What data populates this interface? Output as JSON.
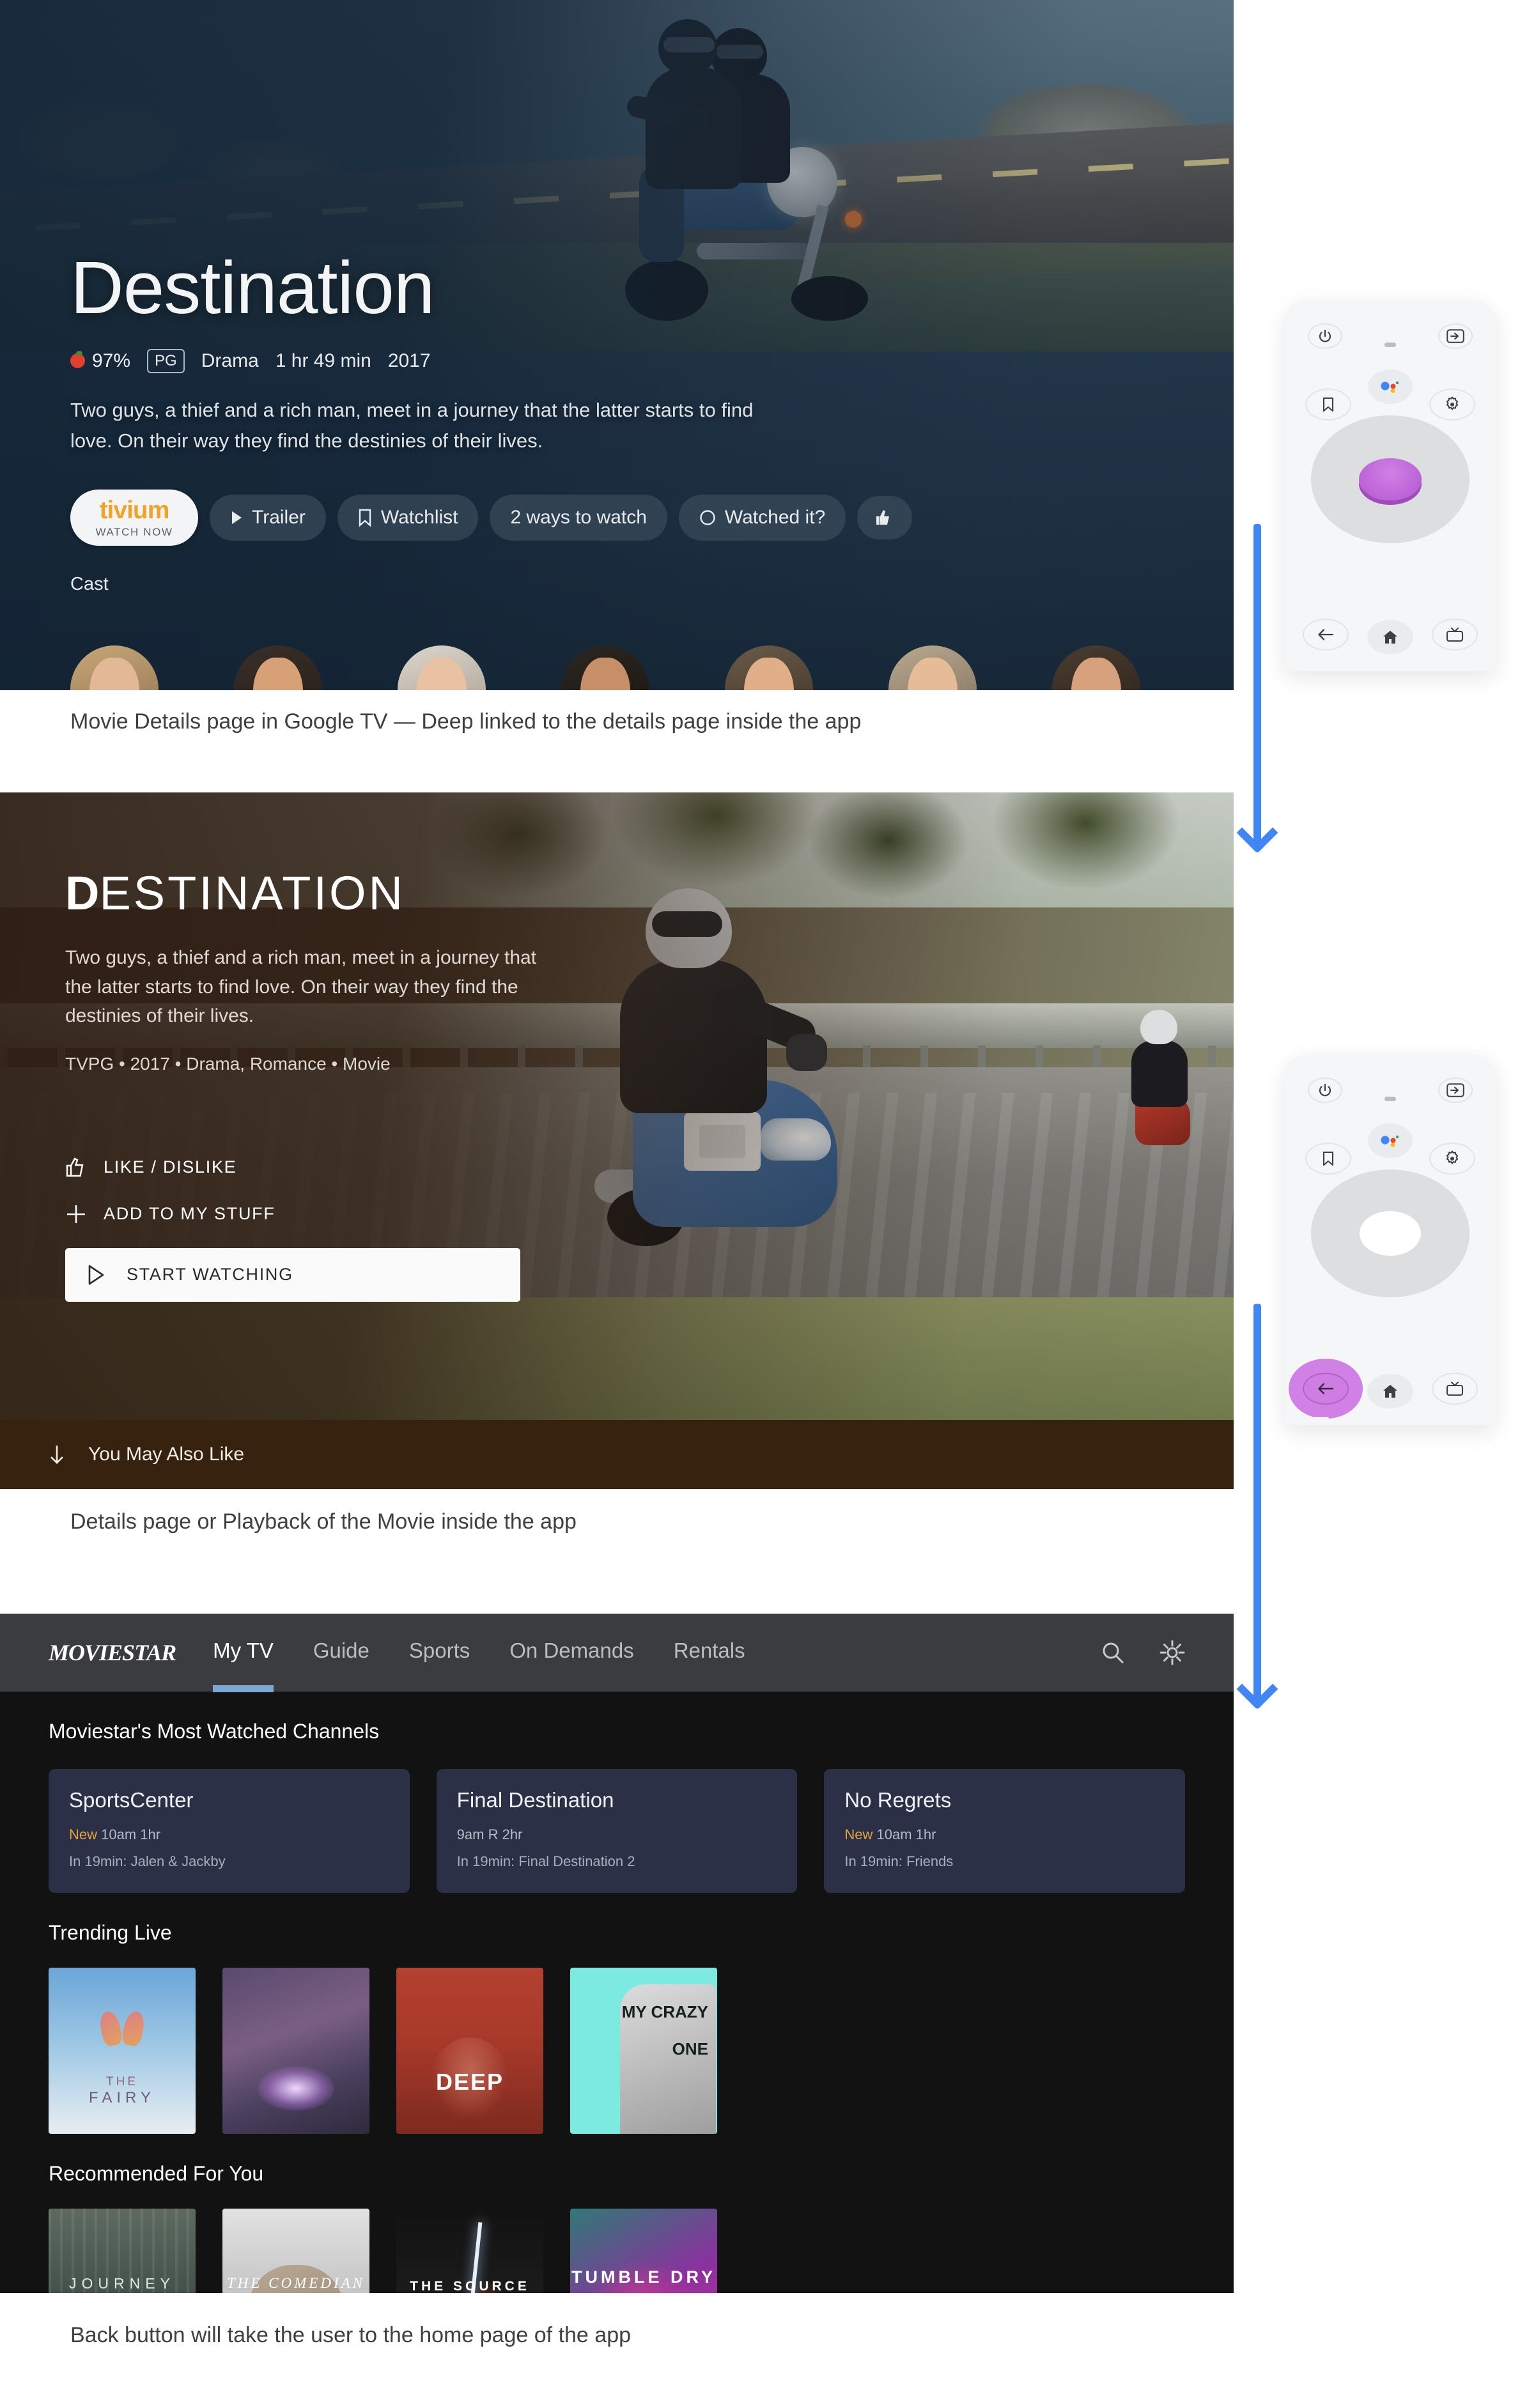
{
  "panel1": {
    "title": "Destination",
    "score": "97%",
    "rating": "PG",
    "genre": "Drama",
    "duration": "1 hr 49 min",
    "year": "2017",
    "description": "Two guys, a thief and a rich man, meet in a journey that the latter starts to find love. On their way they find the destinies of their lives.",
    "provider_button": {
      "name": "tivium",
      "sub": "WATCH NOW"
    },
    "actions": [
      {
        "label": "Trailer",
        "icon": "play-icon"
      },
      {
        "label": "Watchlist",
        "icon": "bookmark-icon"
      },
      {
        "label": "2 ways to watch",
        "icon": "none"
      },
      {
        "label": "Watched it?",
        "icon": "circle-icon"
      },
      {
        "label": "",
        "icon": "thumbs-icon"
      }
    ],
    "cast_label": "Cast"
  },
  "caption1": "Movie Details page in Google TV — Deep linked to the details page inside the app",
  "panel2": {
    "title_first": "D",
    "title_rest": "ESTINATION",
    "description": "Two guys, a thief and a rich man, meet in a journey that the latter starts to find love. On their way they find the destinies of their lives.",
    "meta": "TVPG • 2017 • Drama, Romance • Movie",
    "like_label": "LIKE / DISLIKE",
    "add_label": "ADD TO MY STUFF",
    "cta_label": "START WATCHING",
    "bottom_bar_label": "You May Also Like"
  },
  "caption2": "Details page or Playback of the Movie inside the app",
  "panel3": {
    "logo": "MOVIESTAR",
    "tabs": [
      {
        "label": "My TV",
        "active": true
      },
      {
        "label": "Guide",
        "active": false
      },
      {
        "label": "Sports",
        "active": false
      },
      {
        "label": "On Demands",
        "active": false
      },
      {
        "label": "Rentals",
        "active": false
      }
    ],
    "nav_icons": [
      "search-icon",
      "gear-icon"
    ],
    "section_channels": "Moviestar's Most Watched Channels",
    "channels": [
      {
        "title": "SportsCenter",
        "badge": "New",
        "time": "10am 1hr",
        "next": "In 19min: Jalen & Jackby"
      },
      {
        "title": "Final Destination",
        "badge": "",
        "time": "9am R 2hr",
        "next": "In 19min: Final Destination 2"
      },
      {
        "title": "No Regrets",
        "badge": "New",
        "time": "10am 1hr",
        "next": "In 19min: Friends"
      }
    ],
    "section_trending": "Trending Live",
    "trending": [
      {
        "title_1": "THE",
        "title_2": "FAIRY",
        "art": "art-fairy"
      },
      {
        "title_1": "",
        "title_2": "",
        "art": "art-wolf"
      },
      {
        "title_1": "",
        "title_2": "DEEP",
        "art": "art-deep"
      },
      {
        "title_1": "MY CRAZY",
        "title_2": "ONE",
        "art": "art-crazy"
      }
    ],
    "section_recommended": "Recommended For You",
    "recommended": [
      {
        "title": "JOURNEY",
        "art": "art-journey"
      },
      {
        "title": "THE COMEDIAN",
        "art": "art-comedian"
      },
      {
        "title": "THE SOURCE",
        "art": "art-source"
      },
      {
        "title": "TUMBLE DRY",
        "art": "art-tumble"
      }
    ]
  },
  "caption3": "Back button will take the user to the home page of the app",
  "remote1": {
    "buttons": [
      "power-icon",
      "input-icon",
      "bookmark-icon",
      "google-assistant-icon",
      "gear-icon",
      "dpad",
      "ok-button",
      "back-icon",
      "home-icon",
      "live-tv-icon"
    ],
    "highlight": "ok-button"
  },
  "remote2": {
    "buttons": [
      "power-icon",
      "input-icon",
      "bookmark-icon",
      "google-assistant-icon",
      "gear-icon",
      "dpad",
      "ok-button",
      "back-icon",
      "home-icon",
      "live-tv-icon"
    ],
    "highlight": "back-icon"
  },
  "colors": {
    "arrow": "#4285f4",
    "accent_tab": "#7da8d6",
    "badge_new": "#e8a23c",
    "tivium": "#f0a32a",
    "remote_highlight": "#cf7ce3"
  }
}
